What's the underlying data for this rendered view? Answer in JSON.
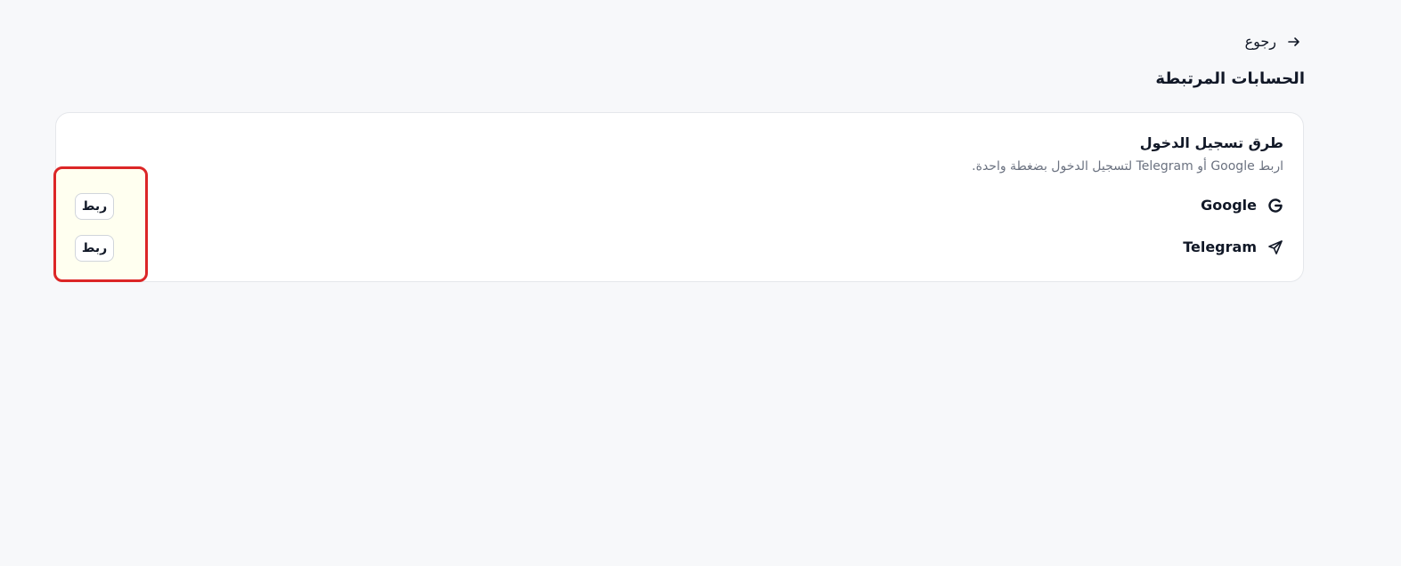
{
  "header": {
    "back_label": "رجوع",
    "back_icon": "arrow-right-icon",
    "page_title": "الحسابات المرتبطة"
  },
  "login_methods": {
    "title": "طرق تسجيل الدخول",
    "subtitle": "اربط Google أو Telegram لتسجيل الدخول بضغطة واحدة.",
    "providers": [
      {
        "name": "Google",
        "icon": "google-icon",
        "action_label": "ربط"
      },
      {
        "name": "Telegram",
        "icon": "telegram-icon",
        "action_label": "ربط"
      }
    ]
  },
  "colors": {
    "highlight_border": "#dc2626",
    "highlight_fill": "#fffff0",
    "subtitle_text": "#6b7280"
  }
}
